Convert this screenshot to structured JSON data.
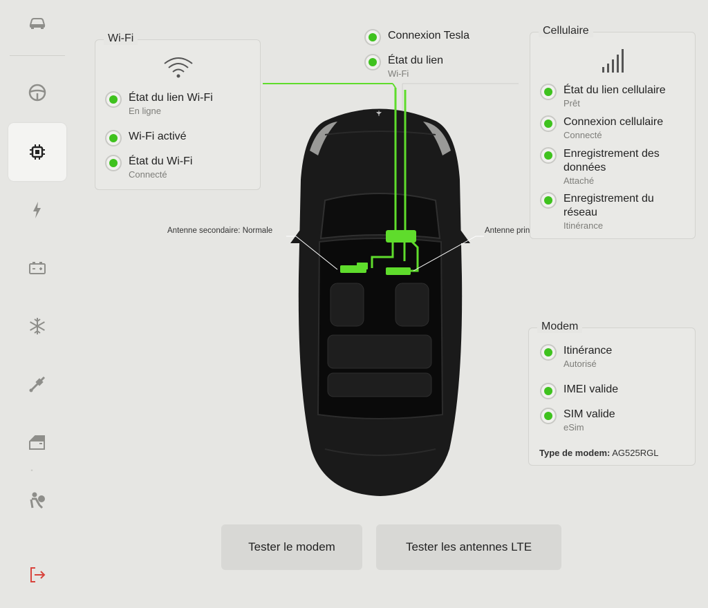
{
  "sidebar": {
    "items": [
      {
        "name": "car-icon"
      },
      {
        "name": "steering-wheel-icon"
      },
      {
        "name": "chip-icon",
        "active": true
      },
      {
        "name": "lightning-icon"
      },
      {
        "name": "battery-icon"
      },
      {
        "name": "snowflake-icon"
      },
      {
        "name": "suspension-icon"
      },
      {
        "name": "door-icon"
      },
      {
        "name": "airbag-icon"
      },
      {
        "name": "exit-icon"
      }
    ]
  },
  "wifi": {
    "title": "Wi-Fi",
    "link_label": "État du lien Wi-Fi",
    "link_value": "En ligne",
    "enabled_label": "Wi-Fi activé",
    "state_label": "État du Wi-Fi",
    "state_value": "Connecté"
  },
  "tesla": {
    "connection_label": "Connexion Tesla",
    "link_label": "État du lien",
    "link_value": "Wi-Fi"
  },
  "cellular": {
    "title": "Cellulaire",
    "link_label": "État du lien cellulaire",
    "link_value": "Prêt",
    "connection_label": "Connexion cellulaire",
    "connection_value": "Connecté",
    "data_reg_label_1": "Enregistrement des",
    "data_reg_label_2": "données",
    "data_reg_value": "Attaché",
    "net_reg_label_1": "Enregistrement du",
    "net_reg_label_2": "réseau",
    "net_reg_value": "Itinérance"
  },
  "modem": {
    "title": "Modem",
    "roaming_label": "Itinérance",
    "roaming_value": "Autorisé",
    "imei_label": "IMEI valide",
    "sim_label": "SIM valide",
    "sim_value": "eSim",
    "type_label": "Type de modem:",
    "type_value": "AG525RGL"
  },
  "antennas": {
    "secondary": "Antenne secondaire: Normale",
    "primary": "Antenne principale: Normale"
  },
  "buttons": {
    "test_modem": "Tester le modem",
    "test_lte": "Tester les antennes LTE"
  },
  "colors": {
    "status_ok": "#3fc21e",
    "wire": "#5fdc2c",
    "background": "#e6e6e3"
  }
}
